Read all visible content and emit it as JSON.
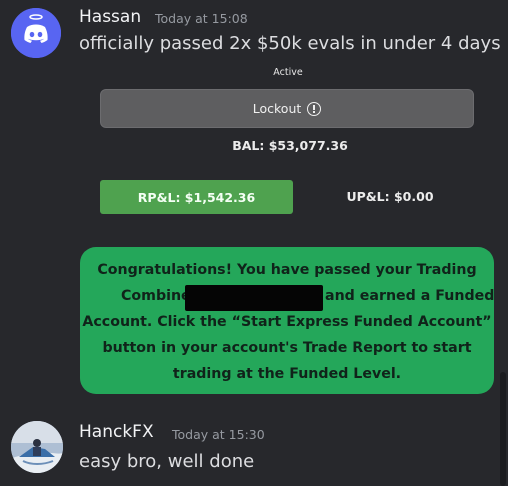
{
  "messages": [
    {
      "author": "Hassan",
      "timestamp": "Today at 15:08",
      "text": "officially passed 2x $50k evals in under 4 days",
      "avatar_icon": "discord-logo-icon",
      "avatar_color": "#5865f2"
    },
    {
      "author": "HanckFX",
      "timestamp": "Today at 15:30",
      "text": "easy bro, well done",
      "avatar_icon": "user-avatar-icon"
    }
  ],
  "attachment": {
    "status": "Active",
    "lockout_label": "Lockout",
    "balance": "BAL: $53,077.36",
    "realized_pnl": "RP&L: $1,542.36",
    "unrealized_pnl": "UP&L: $0.00",
    "congrats_lines": [
      "Congratulations! You have passed your Trading",
      "Combine",
      "and earned a Funded",
      "Account. Click the “Start Express Funded Account”",
      "button in your account's Trade Report to start",
      "trading at the Funded Level."
    ],
    "colors": {
      "congrats_bg": "#24a75a",
      "rpl_bg": "#4fa24f",
      "lockout_bg": "#5e5e60"
    }
  }
}
